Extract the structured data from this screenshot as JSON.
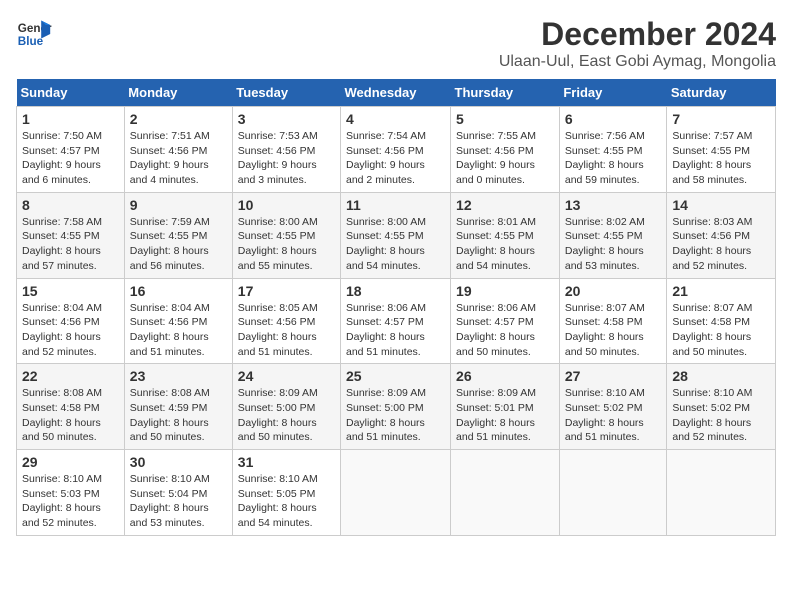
{
  "logo": {
    "line1": "General",
    "line2": "Blue"
  },
  "title": "December 2024",
  "subtitle": "Ulaan-Uul, East Gobi Aymag, Mongolia",
  "days_of_week": [
    "Sunday",
    "Monday",
    "Tuesday",
    "Wednesday",
    "Thursday",
    "Friday",
    "Saturday"
  ],
  "weeks": [
    [
      {
        "day": 1,
        "sunrise": "7:50 AM",
        "sunset": "4:57 PM",
        "daylight": "9 hours and 6 minutes."
      },
      {
        "day": 2,
        "sunrise": "7:51 AM",
        "sunset": "4:56 PM",
        "daylight": "9 hours and 4 minutes."
      },
      {
        "day": 3,
        "sunrise": "7:53 AM",
        "sunset": "4:56 PM",
        "daylight": "9 hours and 3 minutes."
      },
      {
        "day": 4,
        "sunrise": "7:54 AM",
        "sunset": "4:56 PM",
        "daylight": "9 hours and 2 minutes."
      },
      {
        "day": 5,
        "sunrise": "7:55 AM",
        "sunset": "4:56 PM",
        "daylight": "9 hours and 0 minutes."
      },
      {
        "day": 6,
        "sunrise": "7:56 AM",
        "sunset": "4:55 PM",
        "daylight": "8 hours and 59 minutes."
      },
      {
        "day": 7,
        "sunrise": "7:57 AM",
        "sunset": "4:55 PM",
        "daylight": "8 hours and 58 minutes."
      }
    ],
    [
      {
        "day": 8,
        "sunrise": "7:58 AM",
        "sunset": "4:55 PM",
        "daylight": "8 hours and 57 minutes."
      },
      {
        "day": 9,
        "sunrise": "7:59 AM",
        "sunset": "4:55 PM",
        "daylight": "8 hours and 56 minutes."
      },
      {
        "day": 10,
        "sunrise": "8:00 AM",
        "sunset": "4:55 PM",
        "daylight": "8 hours and 55 minutes."
      },
      {
        "day": 11,
        "sunrise": "8:00 AM",
        "sunset": "4:55 PM",
        "daylight": "8 hours and 54 minutes."
      },
      {
        "day": 12,
        "sunrise": "8:01 AM",
        "sunset": "4:55 PM",
        "daylight": "8 hours and 54 minutes."
      },
      {
        "day": 13,
        "sunrise": "8:02 AM",
        "sunset": "4:55 PM",
        "daylight": "8 hours and 53 minutes."
      },
      {
        "day": 14,
        "sunrise": "8:03 AM",
        "sunset": "4:56 PM",
        "daylight": "8 hours and 52 minutes."
      }
    ],
    [
      {
        "day": 15,
        "sunrise": "8:04 AM",
        "sunset": "4:56 PM",
        "daylight": "8 hours and 52 minutes."
      },
      {
        "day": 16,
        "sunrise": "8:04 AM",
        "sunset": "4:56 PM",
        "daylight": "8 hours and 51 minutes."
      },
      {
        "day": 17,
        "sunrise": "8:05 AM",
        "sunset": "4:56 PM",
        "daylight": "8 hours and 51 minutes."
      },
      {
        "day": 18,
        "sunrise": "8:06 AM",
        "sunset": "4:57 PM",
        "daylight": "8 hours and 51 minutes."
      },
      {
        "day": 19,
        "sunrise": "8:06 AM",
        "sunset": "4:57 PM",
        "daylight": "8 hours and 50 minutes."
      },
      {
        "day": 20,
        "sunrise": "8:07 AM",
        "sunset": "4:58 PM",
        "daylight": "8 hours and 50 minutes."
      },
      {
        "day": 21,
        "sunrise": "8:07 AM",
        "sunset": "4:58 PM",
        "daylight": "8 hours and 50 minutes."
      }
    ],
    [
      {
        "day": 22,
        "sunrise": "8:08 AM",
        "sunset": "4:58 PM",
        "daylight": "8 hours and 50 minutes."
      },
      {
        "day": 23,
        "sunrise": "8:08 AM",
        "sunset": "4:59 PM",
        "daylight": "8 hours and 50 minutes."
      },
      {
        "day": 24,
        "sunrise": "8:09 AM",
        "sunset": "5:00 PM",
        "daylight": "8 hours and 50 minutes."
      },
      {
        "day": 25,
        "sunrise": "8:09 AM",
        "sunset": "5:00 PM",
        "daylight": "8 hours and 51 minutes."
      },
      {
        "day": 26,
        "sunrise": "8:09 AM",
        "sunset": "5:01 PM",
        "daylight": "8 hours and 51 minutes."
      },
      {
        "day": 27,
        "sunrise": "8:10 AM",
        "sunset": "5:02 PM",
        "daylight": "8 hours and 51 minutes."
      },
      {
        "day": 28,
        "sunrise": "8:10 AM",
        "sunset": "5:02 PM",
        "daylight": "8 hours and 52 minutes."
      }
    ],
    [
      {
        "day": 29,
        "sunrise": "8:10 AM",
        "sunset": "5:03 PM",
        "daylight": "8 hours and 52 minutes."
      },
      {
        "day": 30,
        "sunrise": "8:10 AM",
        "sunset": "5:04 PM",
        "daylight": "8 hours and 53 minutes."
      },
      {
        "day": 31,
        "sunrise": "8:10 AM",
        "sunset": "5:05 PM",
        "daylight": "8 hours and 54 minutes."
      },
      null,
      null,
      null,
      null
    ]
  ]
}
